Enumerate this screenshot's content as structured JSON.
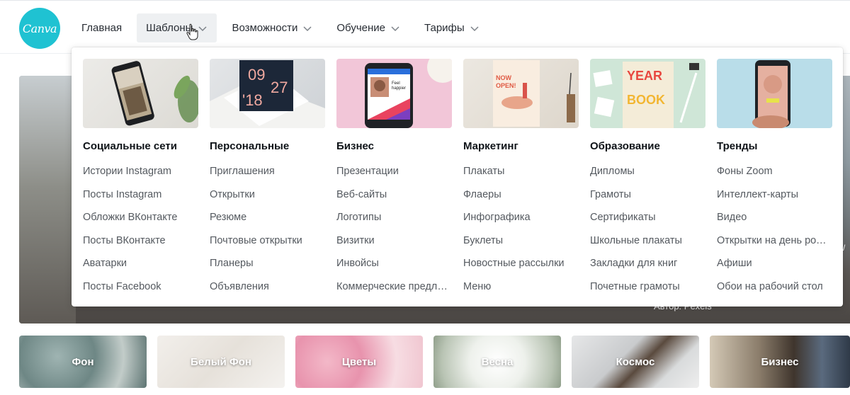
{
  "header": {
    "logo_text": "Canva",
    "nav": [
      {
        "label": "Главная",
        "has_chevron": false
      },
      {
        "label": "Шаблоны",
        "has_chevron": true,
        "active": true
      },
      {
        "label": "Возможности",
        "has_chevron": true
      },
      {
        "label": "Обучение",
        "has_chevron": true
      },
      {
        "label": "Тарифы",
        "has_chevron": true
      }
    ]
  },
  "hero": {
    "credit": "Автор: Pexels",
    "right_text": "/"
  },
  "dropdown": {
    "columns": [
      {
        "title": "Социальные сети",
        "links": [
          "Истории Instagram",
          "Посты Instagram",
          "Обложки ВКонтакте",
          "Посты ВКонтакте",
          "Аватарки",
          "Посты Facebook"
        ]
      },
      {
        "title": "Персональные",
        "links": [
          "Приглашения",
          "Открытки",
          "Резюме",
          "Почтовые открытки",
          "Планеры",
          "Объявления"
        ],
        "thumb_text": [
          "09",
          "27",
          "'18"
        ]
      },
      {
        "title": "Бизнес",
        "links": [
          "Презентации",
          "Веб-сайты",
          "Логотипы",
          "Визитки",
          "Инвойсы",
          "Коммерческие предложения"
        ],
        "thumb_text": [
          "Feel",
          "happier"
        ]
      },
      {
        "title": "Маркетинг",
        "links": [
          "Плакаты",
          "Флаеры",
          "Инфографика",
          "Буклеты",
          "Новостные рассылки",
          "Меню"
        ],
        "thumb_text": [
          "NOW",
          "OPEN!"
        ]
      },
      {
        "title": "Образование",
        "links": [
          "Дипломы",
          "Грамоты",
          "Сертификаты",
          "Школьные плакаты",
          "Закладки для книг",
          "Почетные грамоты"
        ],
        "thumb_text": [
          "YEAR",
          "BOOK"
        ]
      },
      {
        "title": "Тренды",
        "links": [
          "Фоны Zoom",
          "Интеллект-карты",
          "Видео",
          "Открытки на день рождения",
          "Афиши",
          "Обои на рабочий стол"
        ]
      }
    ]
  },
  "tiles": [
    "Фон",
    "Белый Фон",
    "Цветы",
    "Весна",
    "Космос",
    "Бизнес"
  ],
  "colors": {
    "brand": "#1fc2d2",
    "nav_active_bg": "#eef0f2",
    "link": "#54595f",
    "title": "#0e1318"
  }
}
